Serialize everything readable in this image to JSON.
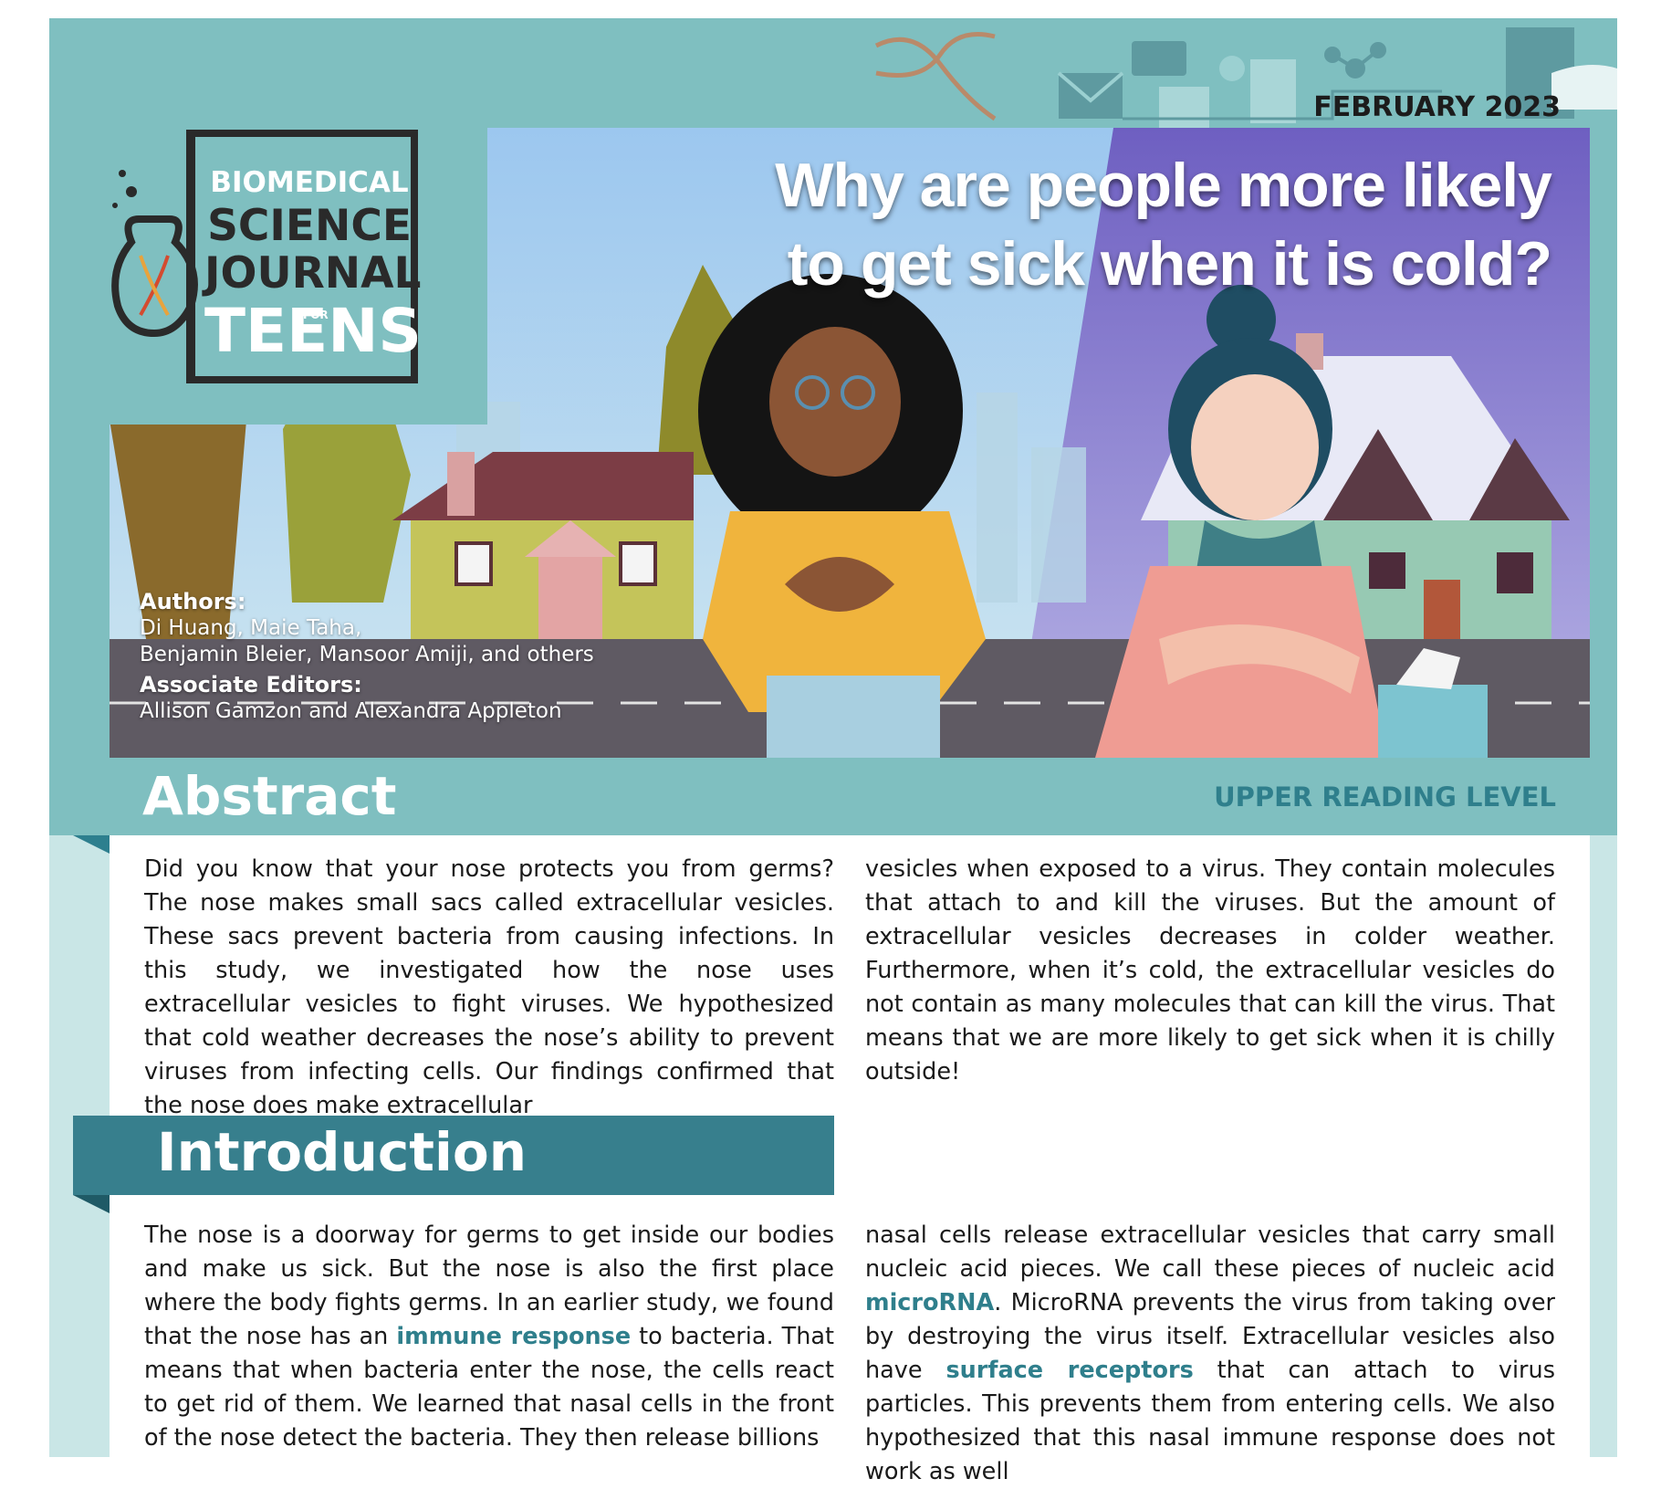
{
  "header": {
    "date": "FEBRUARY 2023",
    "title_line1": "Why are people more likely",
    "title_line2": "to get sick when it is cold?"
  },
  "logo": {
    "line1": "BIOMEDICAL",
    "line2": "SCIENCE",
    "line3": "JOURNAL",
    "line4": "TEENS",
    "for": "FOR"
  },
  "credits": {
    "authors_label": "Authors:",
    "authors_line1": "Di Huang, Maie Taha,",
    "authors_line2": "Benjamin Bleier, Mansoor Amiji, and others",
    "editors_label": "Associate Editors:",
    "editors": "Allison Gamzon and Alexandra Appleton"
  },
  "abstract": {
    "heading": "Abstract",
    "reading_level": "UPPER READING LEVEL",
    "col1": "Did you know that your nose protects you from germs? The nose makes small sacs called extracellular vesicles. These sacs prevent bacteria from causing infections. In this study, we investigated how the nose uses extracellular vesicles to fight viruses. We hypothesized that cold weather decreases the nose’s ability to prevent viruses from infecting cells. Our findings confirmed that the nose does make extracellular",
    "col2": "vesicles when exposed to a virus. They contain molecules that attach to and kill the viruses. But the amount of extracellular vesicles decreases in colder weather. Furthermore, when it’s cold, the extracellular vesicles do not contain as many molecules that can kill the virus. That means that we are more likely to get sick when it is chilly outside!"
  },
  "introduction": {
    "heading": "Introduction",
    "col1_a": "The nose is a doorway for germs to get inside our bodies and make us sick. But the nose is also the first place where the body fights germs. In an earlier study, we found that the nose has an ",
    "col1_kw": "immune response",
    "col1_b": " to bacteria. That means that when bacteria enter the nose, the cells react to get rid of them. We learned that nasal cells in the front of the nose detect the bacteria. They then release billions",
    "col2_a": "nasal cells release extracellular vesicles that carry small nucleic acid pieces. We call these pieces of nucleic acid ",
    "col2_kw1": "microRNA",
    "col2_b": ". MicroRNA prevents the virus from taking over by destroying the virus itself. Extracellular vesicles also have ",
    "col2_kw2": "surface receptors",
    "col2_c": " that can attach to virus particles. This prevents them from entering cells. We also hypothesized that this nasal immune response does not work as well"
  },
  "colors": {
    "teal_light": "#7fbfc0",
    "teal_dark": "#377f8d",
    "keyword": "#2f7f8c",
    "page_bg": "#c9e6e6"
  }
}
